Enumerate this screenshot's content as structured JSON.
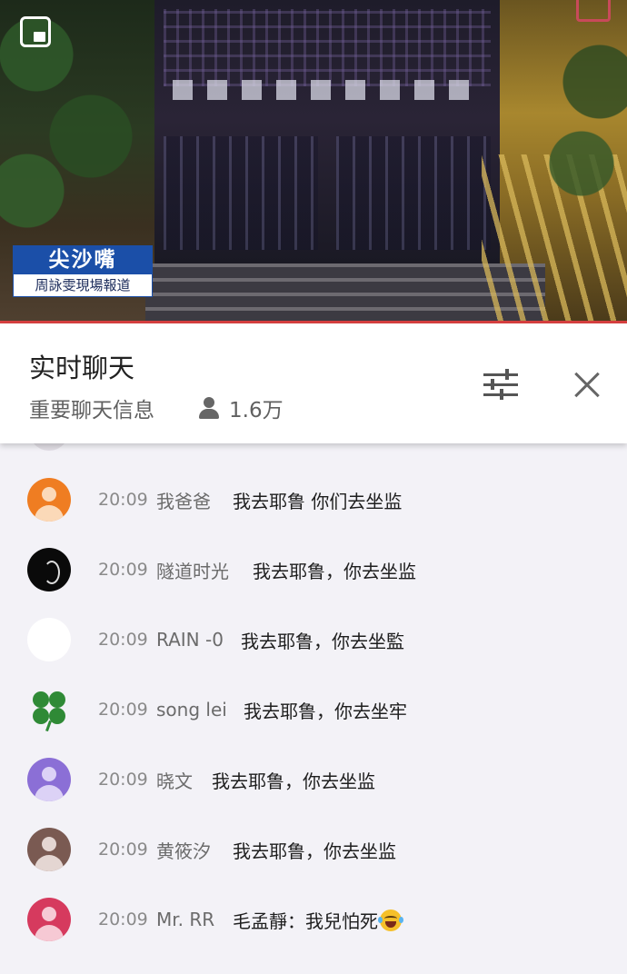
{
  "video": {
    "location_caption": "尖沙嘴",
    "sub_caption": "周詠雯現場報道"
  },
  "chat": {
    "title": "实时聊天",
    "mode": "重要聊天信息",
    "viewer_count": "1.6万"
  },
  "messages": [
    {
      "time": "20:09",
      "author": "我爸爸",
      "text": "我去耶鲁 你们去坐监",
      "avatar": "default-avatar",
      "avatar_color": "#ef7d22"
    },
    {
      "time": "20:09",
      "author": "隧道时光",
      "text": "我去耶鲁，你去坐监",
      "avatar": "dark-avatar",
      "avatar_color": "#0a0a0a"
    },
    {
      "time": "20:09",
      "author": "RAIN -0",
      "text": "我去耶鲁，你去坐監",
      "avatar": "white-avatar",
      "avatar_color": "#ffffff"
    },
    {
      "time": "20:09",
      "author": "song lei",
      "text": "我去耶鲁，你去坐牢",
      "avatar": "clover-avatar",
      "avatar_color": "#2f8a36"
    },
    {
      "time": "20:09",
      "author": "晓文",
      "text": "我去耶鲁，你去坐监",
      "avatar": "default-avatar",
      "avatar_color": "#8b6fd6"
    },
    {
      "time": "20:09",
      "author": "黄筱汐",
      "text": "我去耶鲁，你去坐监",
      "avatar": "default-avatar",
      "avatar_color": "#7a5a52"
    },
    {
      "time": "20:09",
      "author": "Mr. RR",
      "text": "毛孟靜：我兒怕死",
      "avatar": "default-avatar",
      "avatar_color": "#d63a5e",
      "emoji": "laughing-crying-emoji"
    }
  ]
}
